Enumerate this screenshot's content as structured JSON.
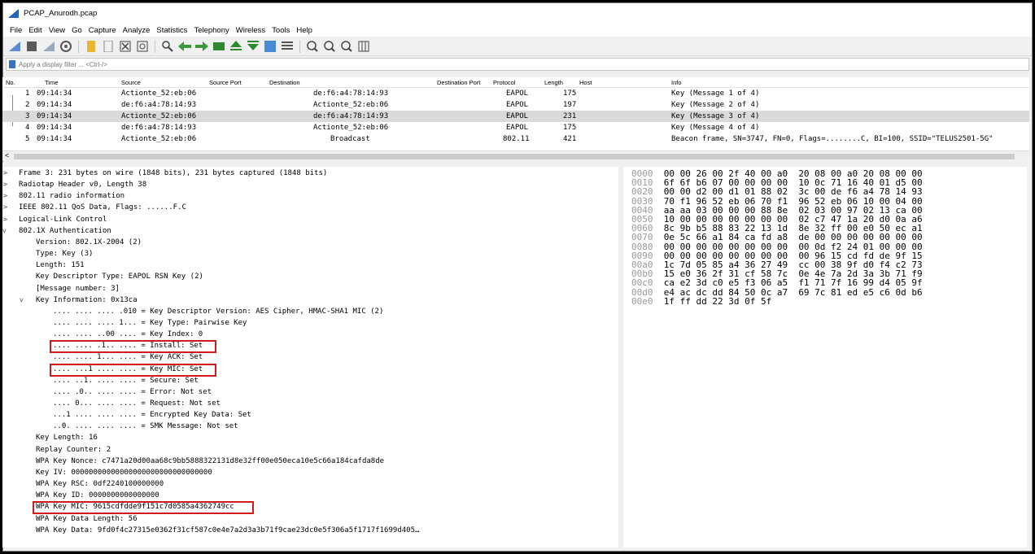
{
  "window": {
    "title": "PCAP_Anurodh.pcap"
  },
  "menu": [
    "File",
    "Edit",
    "View",
    "Go",
    "Capture",
    "Analyze",
    "Statistics",
    "Telephony",
    "Wireless",
    "Tools",
    "Help"
  ],
  "filter": {
    "placeholder": "Apply a display filter ... <Ctrl-/>"
  },
  "packet_list": {
    "columns": [
      "No.",
      "Time",
      "Source",
      "Source Port",
      "Destination",
      "Destination Port",
      "Protocol",
      "Length",
      "Host",
      "Info"
    ],
    "rows": [
      {
        "no": "1",
        "time": "09:14:34",
        "source": "Actionte_52:eb:06",
        "destination": "de:f6:a4:78:14:93",
        "protocol": "EAPOL",
        "length": "175",
        "info": "Key (Message 1 of 4)"
      },
      {
        "no": "2",
        "time": "09:14:34",
        "source": "de:f6:a4:78:14:93",
        "destination": "Actionte_52:eb:06",
        "protocol": "EAPOL",
        "length": "197",
        "info": "Key (Message 2 of 4)"
      },
      {
        "no": "3",
        "time": "09:14:34",
        "source": "Actionte_52:eb:06",
        "destination": "de:f6:a4:78:14:93",
        "protocol": "EAPOL",
        "length": "231",
        "info": "Key (Message 3 of 4)"
      },
      {
        "no": "4",
        "time": "09:14:34",
        "source": "de:f6:a4:78:14:93",
        "destination": "Actionte_52:eb:06",
        "protocol": "EAPOL",
        "length": "175",
        "info": "Key (Message 4 of 4)"
      },
      {
        "no": "5",
        "time": "09:14:34",
        "source": "Actionte_52:eb:06",
        "destination": "Broadcast",
        "protocol": "802.11",
        "length": "421",
        "info": "Beacon frame, SN=3747, FN=0, Flags=........C, BI=100, SSID=\"TELUS2501-5G\""
      }
    ]
  },
  "details": [
    {
      "text": "Frame 3: 231 bytes on wire (1848 bits), 231 bytes captured (1848 bits)",
      "chev": ">"
    },
    {
      "text": "Radiotap Header v0, Length 38",
      "chev": ">"
    },
    {
      "text": "802.11 radio information",
      "chev": ">"
    },
    {
      "text": "IEEE 802.11 QoS Data, Flags: ......F.C",
      "chev": ">"
    },
    {
      "text": "Logical-Link Control",
      "chev": ">"
    },
    {
      "text": "802.1X Authentication",
      "chev": "v"
    },
    {
      "text": "Version: 802.1X-2004 (2)"
    },
    {
      "text": "Type: Key (3)"
    },
    {
      "text": "Length: 151"
    },
    {
      "text": "Key Descriptor Type: EAPOL RSN Key (2)"
    },
    {
      "text": "[Message number: 3]"
    },
    {
      "text": "Key Information: 0x13ca",
      "chev": "v"
    },
    {
      "text": ".... .... .... .010 = Key Descriptor Version: AES Cipher, HMAC-SHA1 MIC (2)"
    },
    {
      "text": ".... .... .... 1... = Key Type: Pairwise Key"
    },
    {
      "text": ".... .... ..00 .... = Key Index: 0"
    },
    {
      "text": ".... .... .1.. .... = Install: Set"
    },
    {
      "text": ".... .... 1... .... = Key ACK: Set"
    },
    {
      "text": ".... ...1 .... .... = Key MIC: Set"
    },
    {
      "text": ".... ..1. .... .... = Secure: Set"
    },
    {
      "text": ".... .0.. .... .... = Error: Not set"
    },
    {
      "text": ".... 0... .... .... = Request: Not set"
    },
    {
      "text": "...1 .... .... .... = Encrypted Key Data: Set"
    },
    {
      "text": "..0. .... .... .... = SMK Message: Not set"
    },
    {
      "text": "Key Length: 16"
    },
    {
      "text": "Replay Counter: 2"
    },
    {
      "text": "WPA Key Nonce: c7471a20d00aa68c9bb5888322131d8e32ff00e050eca10e5c66a184cafda8de"
    },
    {
      "text": "Key IV: 00000000000000000000000000000000"
    },
    {
      "text": "WPA Key RSC: 0df2240100000000"
    },
    {
      "text": "WPA Key ID: 0000000000000000"
    },
    {
      "text": "WPA Key MIC: 9615cdfdde9f151c7d0585a4362749cc"
    },
    {
      "text": "WPA Key Data Length: 56"
    },
    {
      "text": "WPA Key Data: 9fd0f4c27315e0362f31cf587c0e4e7a2d3a3b71f9cae23dc0e5f306a5f1717f1699d405…"
    }
  ],
  "bytes": [
    {
      "off": "0000",
      "hex": "00 00 26 00 2f 40 00 a0  20 08 00 a0 20 08 00 00"
    },
    {
      "off": "0010",
      "hex": "6f 6f b6 07 00 00 00 00  10 0c 71 16 40 01 d5 00"
    },
    {
      "off": "0020",
      "hex": "00 00 d2 00 d1 01 88 02  3c 00 de f6 a4 78 14 93"
    },
    {
      "off": "0030",
      "hex": "70 f1 96 52 eb 06 70 f1  96 52 eb 06 10 00 04 00"
    },
    {
      "off": "0040",
      "hex": "aa aa 03 00 00 00 88 8e  02 03 00 97 02 13 ca 00"
    },
    {
      "off": "0050",
      "hex": "10 00 00 00 00 00 00 00  02 c7 47 1a 20 d0 0a a6"
    },
    {
      "off": "0060",
      "hex": "8c 9b b5 88 83 22 13 1d  8e 32 ff 00 e0 50 ec a1"
    },
    {
      "off": "0070",
      "hex": "0e 5c 66 a1 84 ca fd a8  de 00 00 00 00 00 00 00"
    },
    {
      "off": "0080",
      "hex": "00 00 00 00 00 00 00 00  00 0d f2 24 01 00 00 00"
    },
    {
      "off": "0090",
      "hex": "00 00 00 00 00 00 00 00  00 96 15 cd fd de 9f 15"
    },
    {
      "off": "00a0",
      "hex": "1c 7d 05 85 a4 36 27 49  cc 00 38 9f d0 f4 c2 73"
    },
    {
      "off": "00b0",
      "hex": "15 e0 36 2f 31 cf 58 7c  0e 4e 7a 2d 3a 3b 71 f9"
    },
    {
      "off": "00c0",
      "hex": "ca e2 3d c0 e5 f3 06 a5  f1 71 7f 16 99 d4 05 9f"
    },
    {
      "off": "00d0",
      "hex": "e4 ac dc dd 84 50 0c a7  69 7c 81 ed e5 c6 0d b6"
    },
    {
      "off": "00e0",
      "hex": "1f ff dd 22 3d 0f 5f"
    }
  ],
  "colors": {
    "highlight_box": "#d11a1a",
    "selected_row": "#dadada",
    "shark_blue": "#1f63b5"
  }
}
